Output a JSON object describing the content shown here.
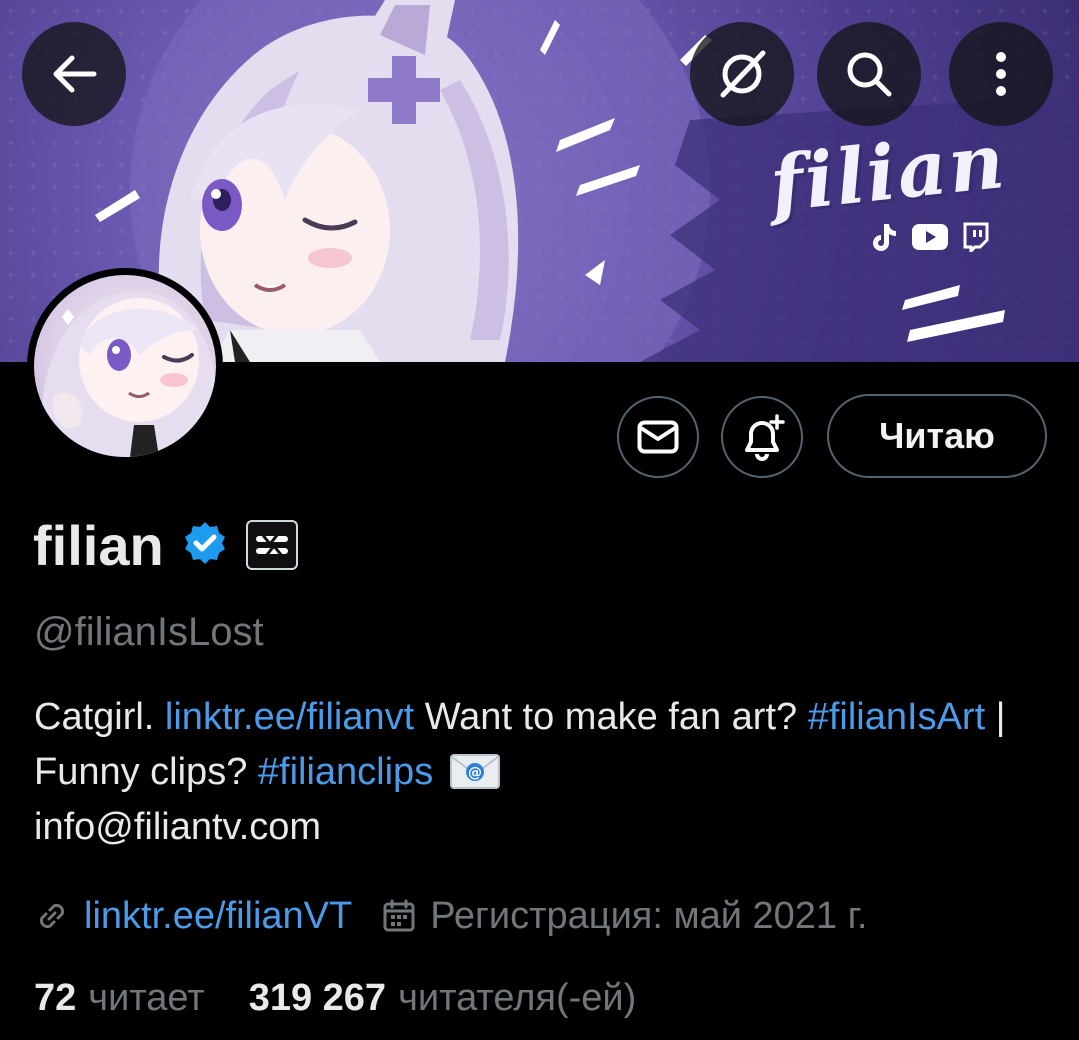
{
  "header": {
    "back_icon": "arrow-left-icon",
    "grok_icon": "grok-slash-circle-icon",
    "search_icon": "search-icon",
    "more_icon": "more-vertical-icon",
    "banner_brand_text": "filian",
    "banner_social_icons": [
      "tiktok-icon",
      "youtube-icon",
      "twitch-icon"
    ]
  },
  "actions": {
    "dm_icon": "mail-icon",
    "notify_icon": "bell-plus-icon",
    "follow_label": "Читаю"
  },
  "profile": {
    "display_name": "filian",
    "verified_icon": "verified-badge-icon",
    "affiliate_icon": "affiliate-logo-icon",
    "handle": "@filianIsLost",
    "bio": {
      "t1": "Catgirl. ",
      "link1": "linktr.ee/filianvt",
      "t2": " Want to make fan art? ",
      "hashtag1": "#filianIsArt",
      "t3": " | Funny clips? ",
      "hashtag2": "#filianclips",
      "t4": "info@filiantv.com"
    },
    "link_icon": "link-icon",
    "website": "linktr.ee/filianVT",
    "calendar_icon": "calendar-icon",
    "joined": "Регистрация: май 2021 г."
  },
  "stats": {
    "following_count": "72",
    "following_label": "читает",
    "followers_count": "319 267",
    "followers_label": "читателя(-ей)"
  },
  "colors": {
    "background": "#000000",
    "text_primary": "#e7e9ea",
    "text_secondary": "#71767b",
    "link": "#4c9be8",
    "verified": "#1d9bf0",
    "banner_purple": "#6b58b0"
  }
}
